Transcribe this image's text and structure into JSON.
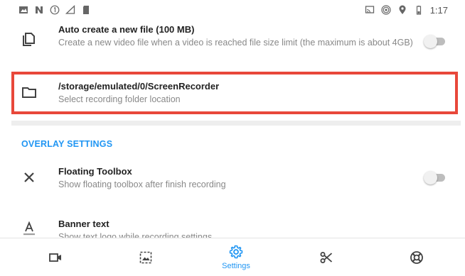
{
  "status_bar": {
    "time": "1:17"
  },
  "settings": {
    "auto_create": {
      "title": "Auto create a new file (100 MB)",
      "subtitle": "Create a new video file when a video is reached file size limit (the maximum is about 4GB)",
      "enabled": false
    },
    "folder": {
      "title": "/storage/emulated/0/ScreenRecorder",
      "subtitle": "Select recording folder location"
    },
    "overlay_section": {
      "header": "OVERLAY SETTINGS"
    },
    "floating_toolbox": {
      "title": "Floating Toolbox",
      "subtitle": "Show floating toolbox after finish recording",
      "enabled": false
    },
    "banner_text": {
      "title": "Banner text",
      "subtitle": "Show text logo while recording settings"
    }
  },
  "bottom_nav": {
    "items": [
      {
        "icon": "video-camera-icon",
        "label": ""
      },
      {
        "icon": "image-gallery-icon",
        "label": ""
      },
      {
        "icon": "settings-gear-icon",
        "label": "Settings",
        "active": true
      },
      {
        "icon": "scissors-icon",
        "label": ""
      },
      {
        "icon": "help-lifebuoy-icon",
        "label": ""
      }
    ]
  },
  "colors": {
    "accent": "#2196f3",
    "highlight_border": "#e8483a",
    "icon_gray": "#424242",
    "subtitle_gray": "#888888"
  }
}
